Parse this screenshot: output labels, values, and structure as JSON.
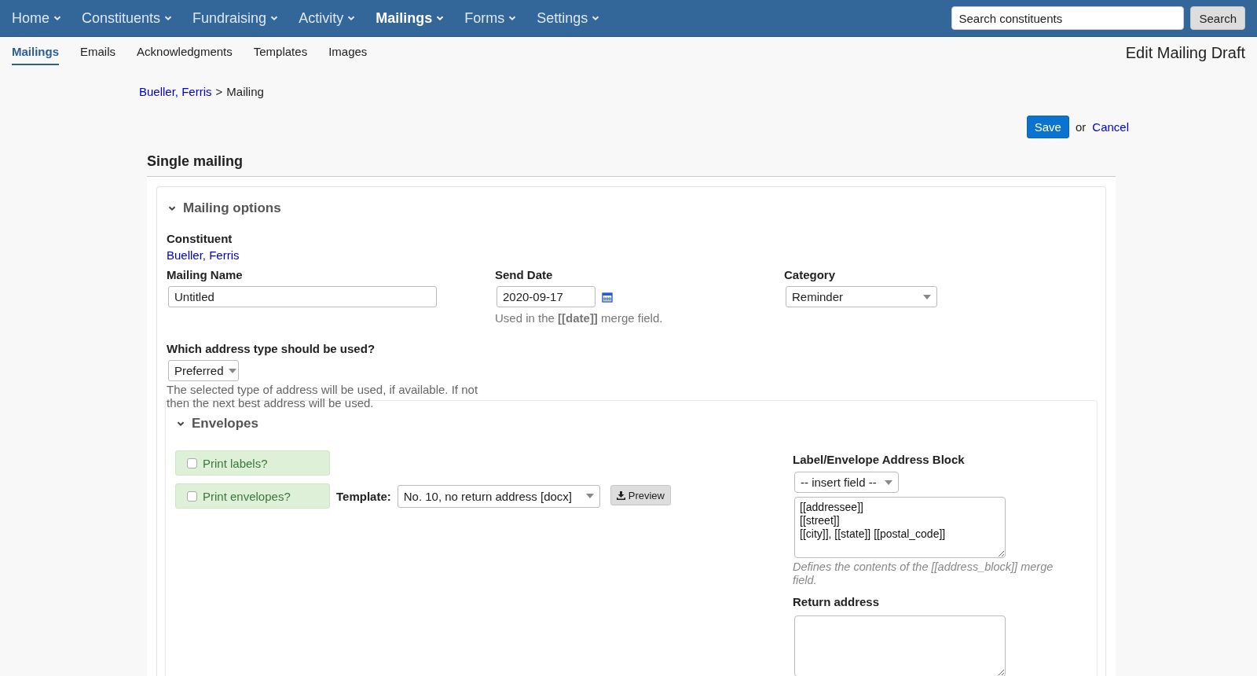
{
  "nav": {
    "items": [
      {
        "label": "Home",
        "selected": false
      },
      {
        "label": "Constituents",
        "selected": false
      },
      {
        "label": "Fundraising",
        "selected": false
      },
      {
        "label": "Activity",
        "selected": false
      },
      {
        "label": "Mailings",
        "selected": true
      },
      {
        "label": "Forms",
        "selected": false
      },
      {
        "label": "Settings",
        "selected": false
      }
    ],
    "search": {
      "placeholder": "Search constituents"
    },
    "search_button": "Search"
  },
  "subnav": {
    "tabs": [
      {
        "label": "Mailings",
        "selected": true
      },
      {
        "label": "Emails",
        "selected": false
      },
      {
        "label": "Acknowledgments",
        "selected": false
      },
      {
        "label": "Templates",
        "selected": false
      },
      {
        "label": "Images",
        "selected": false
      }
    ],
    "page_title": "Edit Mailing Draft"
  },
  "breadcrumb": {
    "link": "Bueller, Ferris",
    "separator": ">",
    "current": "Mailing"
  },
  "actions": {
    "save": "Save",
    "or": "or",
    "cancel": "Cancel"
  },
  "card": {
    "title": "Single mailing",
    "mailing_options": {
      "title": "Mailing options",
      "expanded": true,
      "constituent": {
        "label": "Constituent",
        "value": "Bueller, Ferris"
      },
      "mailing_name": {
        "label": "Mailing Name",
        "value": "Untitled"
      },
      "send_date": {
        "label": "Send Date",
        "value": "2020-09-17",
        "hint": "Used in the **[[date]]** merge field."
      },
      "category": {
        "label": "Category",
        "value": "Reminder"
      },
      "address_type": {
        "label": "Which address type should be used?",
        "value": "Preferred",
        "help": "The selected type of address will be used, if available. If not then the next best address will be used."
      },
      "envelopes": {
        "title": "Envelopes",
        "expanded": true,
        "options": [
          {
            "label": "Print labels?",
            "checked": false
          },
          {
            "label": "Print envelopes?",
            "checked": false
          }
        ],
        "template": {
          "label": "Template:",
          "value": "No. 10, no return address [docx]"
        },
        "preview_button": "Preview",
        "address_block": {
          "label": "Label/Envelope Address Block",
          "insert_field": "-- insert field --",
          "value": "[[addressee]]\n[[street]]\n[[city]], [[state]] [[postal_code]]",
          "hint": "Defines the contents of the [[address_block]] merge field."
        },
        "return_address": {
          "label": "Return address"
        }
      }
    }
  }
}
